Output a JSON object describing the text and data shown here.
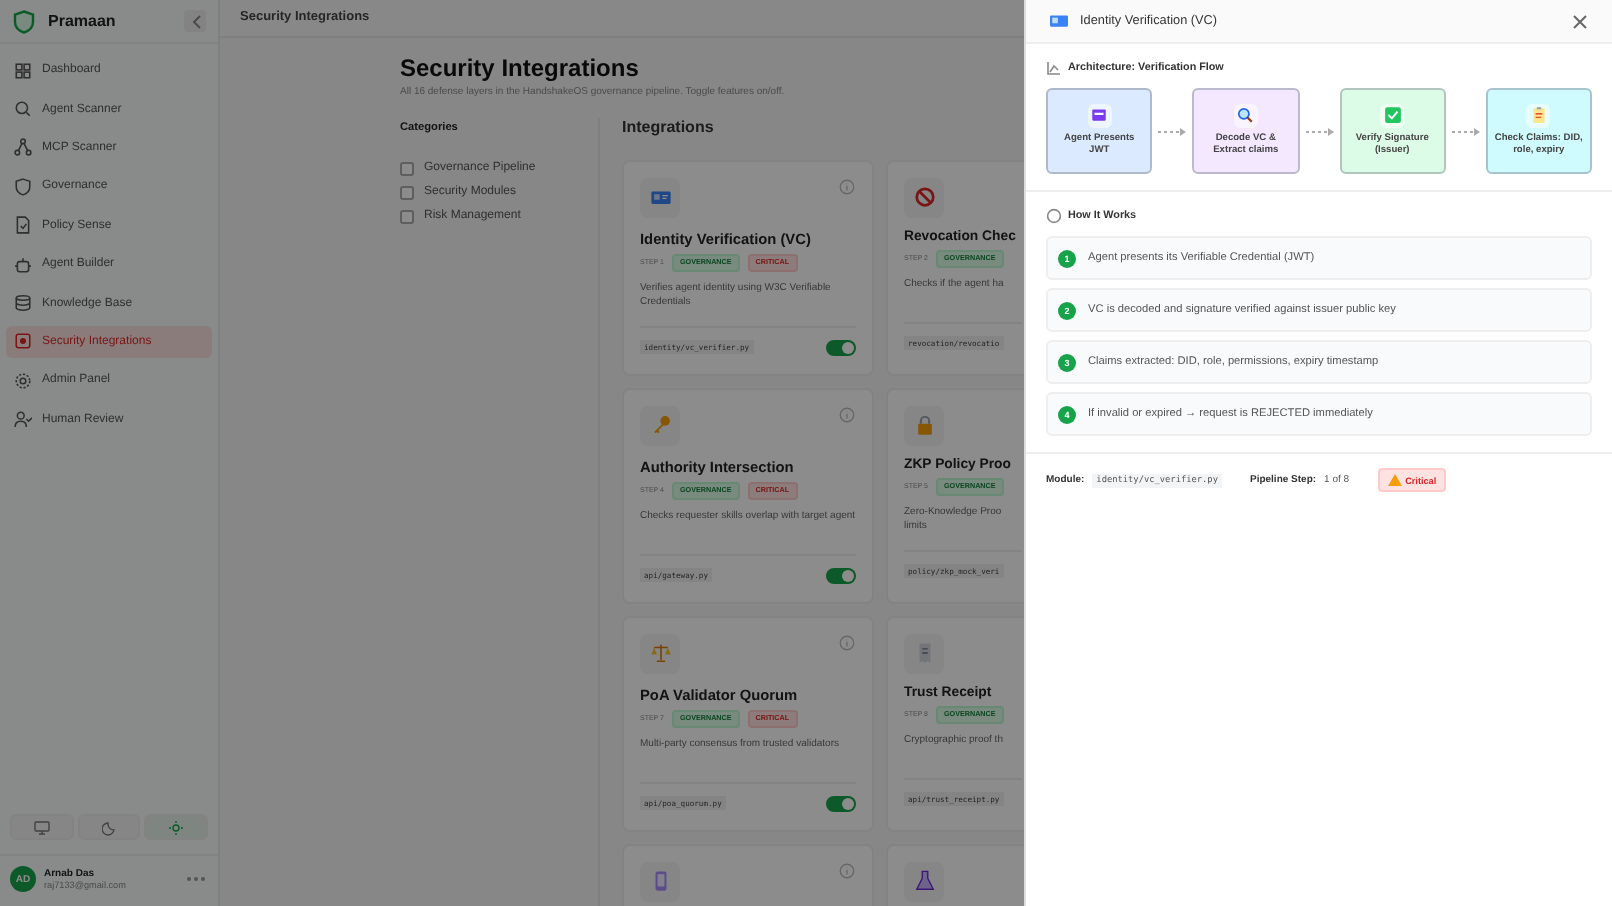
{
  "sidebar": {
    "brand": "Pramaan",
    "items": [
      {
        "label": "Dashboard",
        "selected": false
      },
      {
        "label": "Agent Scanner",
        "selected": false
      },
      {
        "label": "MCP Scanner",
        "selected": false
      },
      {
        "label": "Governance",
        "selected": false
      },
      {
        "label": "Policy Sense",
        "selected": false
      },
      {
        "label": "Agent Builder",
        "selected": false
      },
      {
        "label": "Knowledge Base",
        "selected": false
      },
      {
        "label": "Security Integrations",
        "selected": true
      },
      {
        "label": "Admin Panel",
        "selected": false
      },
      {
        "label": "Human Review",
        "selected": false
      }
    ],
    "theme_buttons": [
      {
        "kind": "monitor",
        "selected": false
      },
      {
        "kind": "moon",
        "selected": false
      },
      {
        "kind": "sun",
        "selected": true
      }
    ],
    "user": {
      "initials": "AD",
      "name": "Arnab Das",
      "email": "raj7133@gmail.com"
    }
  },
  "header": {
    "title": "Security Integrations"
  },
  "page": {
    "title": "Security Integrations",
    "subtitle": "All 16 defense layers in the HandshakeOS governance pipeline. Toggle features on/off.",
    "categories_heading": "Categories",
    "categories": [
      {
        "label": "Governance Pipeline",
        "checked": false
      },
      {
        "label": "Security Modules",
        "checked": false
      },
      {
        "label": "Risk Management",
        "checked": false
      }
    ],
    "integrations_heading": "Integrations",
    "cards": [
      {
        "title": "Identity Verification (VC)",
        "step": "STEP 1",
        "tags": [
          {
            "label": "GOVERNANCE",
            "kind": "gov"
          },
          {
            "label": "CRITICAL",
            "kind": "crit"
          }
        ],
        "description": "Verifies agent identity using W3C Verifiable Credentials",
        "module": "identity/vc_verifier.py",
        "enabled": true
      },
      {
        "title": "Revocation Chec",
        "step": "STEP 2",
        "tags": [
          {
            "label": "GOVERNANCE",
            "kind": "gov"
          }
        ],
        "description": "Checks if the agent ha",
        "module": "revocation/revocatio"
      },
      {
        "title": "Authority Intersection",
        "step": "STEP 4",
        "tags": [
          {
            "label": "GOVERNANCE",
            "kind": "gov"
          },
          {
            "label": "CRITICAL",
            "kind": "crit"
          }
        ],
        "description": "Checks requester skills overlap with target agent",
        "module": "api/gateway.py",
        "enabled": true
      },
      {
        "title": "ZKP Policy Proo",
        "step": "STEP 5",
        "tags": [
          {
            "label": "GOVERNANCE",
            "kind": "gov"
          }
        ],
        "description": "Zero-Knowledge Proo limits",
        "module": "policy/zkp_mock_veri"
      },
      {
        "title": "PoA Validator Quorum",
        "step": "STEP 7",
        "tags": [
          {
            "label": "GOVERNANCE",
            "kind": "gov"
          },
          {
            "label": "CRITICAL",
            "kind": "crit"
          }
        ],
        "description": "Multi-party consensus from trusted validators",
        "module": "api/poa_quorum.py",
        "enabled": true
      },
      {
        "title": "Trust Receipt",
        "step": "STEP 8",
        "tags": [
          {
            "label": "GOVERNANCE",
            "kind": "gov"
          }
        ],
        "description": "Cryptographic proof th",
        "module": "api/trust_receipt.py"
      }
    ]
  },
  "panel": {
    "title": "Identity Verification (VC)",
    "architecture_heading": "Architecture: Verification Flow",
    "flow": [
      {
        "label": "Agent Presents JWT",
        "color": "#dbeafe"
      },
      {
        "label": "Decode VC & Extract claims",
        "color": "#f3e8ff"
      },
      {
        "label": "Verify Signature (Issuer)",
        "color": "#dcfce7"
      },
      {
        "label": "Check Claims: DID, role, expiry",
        "color": "#cffafe"
      }
    ],
    "how_heading": "How It Works",
    "steps": [
      {
        "number": "1",
        "text": "Agent presents its Verifiable Credential (JWT)"
      },
      {
        "number": "2",
        "text": "VC is decoded and signature verified against issuer public key"
      },
      {
        "number": "3",
        "text": "Claims extracted: DID, role, permissions, expiry timestamp"
      },
      {
        "number": "4",
        "text": "If invalid or expired → request is REJECTED immediately"
      }
    ],
    "module_label": "Module:",
    "module": "identity/vc_verifier.py",
    "pipeline_label": "Pipeline Step:",
    "pipeline_value": "1 of 8",
    "severity": "Critical"
  }
}
